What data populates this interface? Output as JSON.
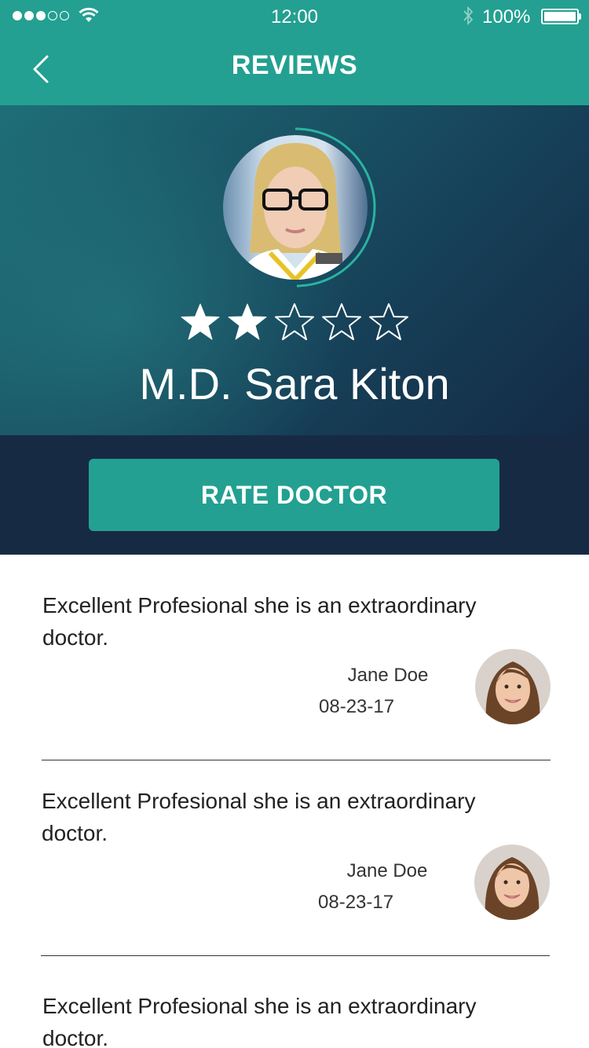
{
  "status_bar": {
    "time": "12:00",
    "battery": "100%"
  },
  "nav": {
    "title": "REVIEWS"
  },
  "doctor": {
    "name": "M.D. Sara Kiton",
    "rating": 2,
    "rating_max": 5
  },
  "rate_button": {
    "label": "RATE DOCTOR"
  },
  "reviews": [
    {
      "text": "Excellent Profesional she is an extraordinary doctor.",
      "author": "Jane Doe",
      "date": "08-23-17"
    },
    {
      "text": "Excellent Profesional she is an extraordinary doctor.",
      "author": "Jane Doe",
      "date": "08-23-17"
    },
    {
      "text": "Excellent Profesional she is an extraordinary doctor."
    }
  ],
  "colors": {
    "accent": "#23a091",
    "dark_navy": "#172a44"
  },
  "icons": [
    "back-chevron-icon",
    "wifi-icon",
    "bluetooth-icon",
    "battery-icon",
    "star-icon"
  ]
}
